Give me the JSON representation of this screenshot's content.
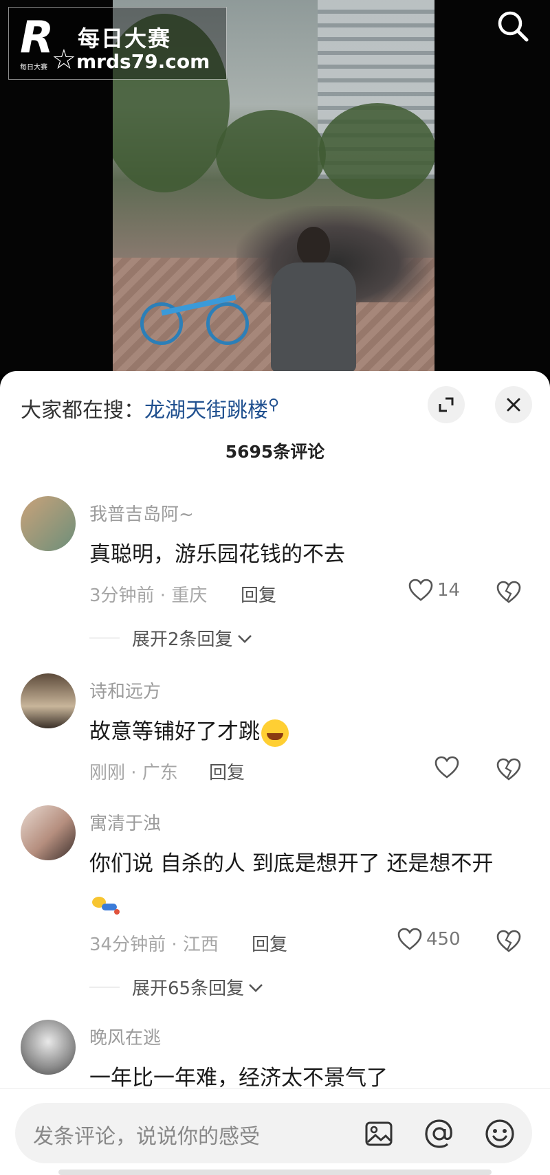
{
  "video": {
    "watermark": {
      "brand_cn": "每日大赛",
      "url": "mrds79.com",
      "small_text": "每日大赛"
    }
  },
  "sheet": {
    "hot_search_label": "大家都在搜：",
    "hot_search_keyword": "龙湖天街跳楼",
    "comment_count": "5695条评论"
  },
  "comments": [
    {
      "username": "我普吉岛阿~",
      "text": "真聪明，游乐园花钱的不去",
      "meta": "3分钟前 · 重庆",
      "reply": "回复",
      "likes": "14",
      "expand": "展开2条回复"
    },
    {
      "username": "诗和远方",
      "text": "故意等铺好了才跳",
      "emoji": "laugh-emoji",
      "meta": "刚刚 · 广东",
      "reply": "回复",
      "likes": ""
    },
    {
      "username": "寓清于浊",
      "text": "你们说 自杀的人 到底是想开了 还是想不开",
      "emoji": "sticker-emoji",
      "meta": "34分钟前 · 江西",
      "reply": "回复",
      "likes": "450",
      "expand": "展开65条回复"
    },
    {
      "username": "晚风在逃",
      "text": "一年比一年难，经济太不景气了"
    }
  ],
  "input_bar": {
    "placeholder": "发条评论，说说你的感受",
    "icons": [
      "image-icon",
      "at-icon",
      "emoji-icon"
    ]
  }
}
